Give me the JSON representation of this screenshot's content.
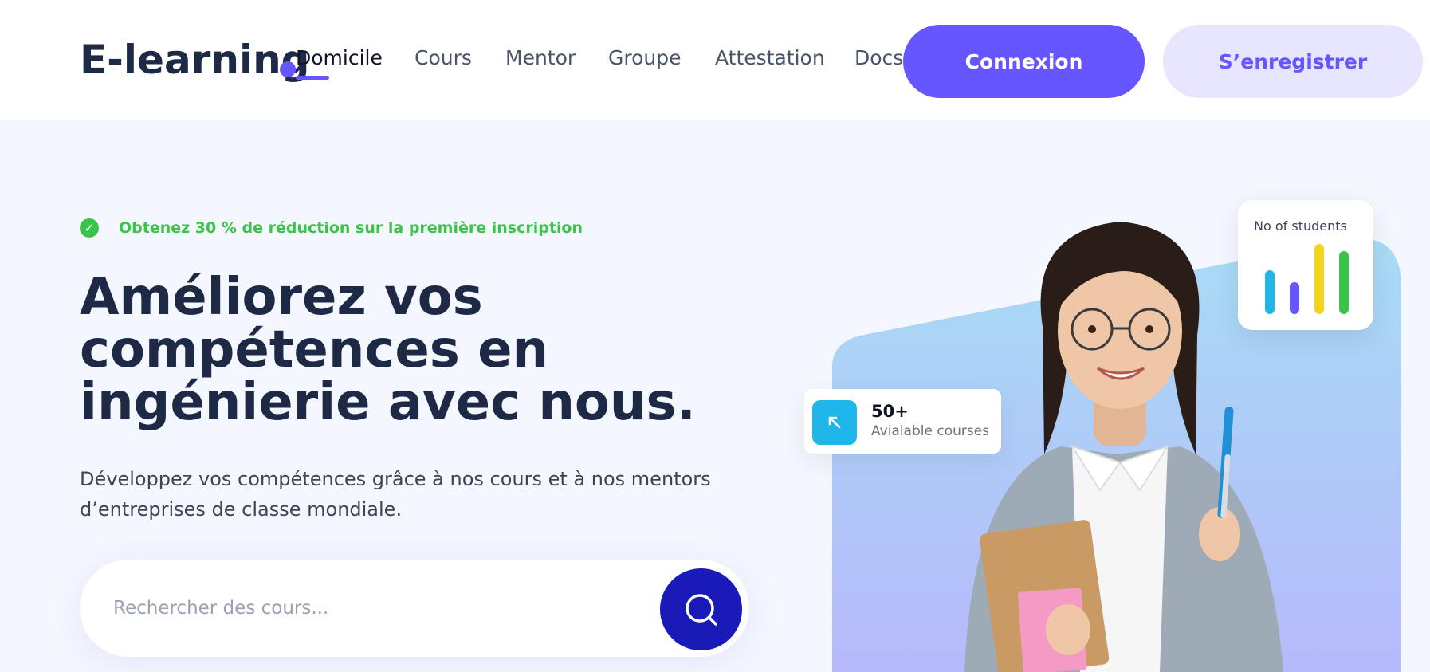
{
  "header": {
    "logo": "E-learning",
    "nav": [
      {
        "label": "Domicile",
        "active": true
      },
      {
        "label": "Cours",
        "active": false
      },
      {
        "label": "Mentor",
        "active": false
      },
      {
        "label": "Groupe",
        "active": false
      },
      {
        "label": "Attestation",
        "active": false
      },
      {
        "label": "Docs",
        "active": false
      }
    ],
    "login_label": "Connexion",
    "register_label": "S’enregistrer"
  },
  "hero": {
    "promo": "Obtenez 30 % de réduction sur la première inscription",
    "title_lines": [
      "Améliorez vos",
      "compétences en",
      "ingénierie avec nous."
    ],
    "description_lines": [
      "Développez vos compétences grâce à nos cours et à nos mentors",
      "d’entreprises de classe mondiale."
    ],
    "search": {
      "placeholder": "Rechercher des cours...",
      "value": ""
    }
  },
  "stats": {
    "students_title": "No of students",
    "students_bars": [
      {
        "level": 0.62,
        "color": "#1fb7ea"
      },
      {
        "level": 0.46,
        "color": "#6556ff"
      },
      {
        "level": 1.0,
        "color": "#f7d41c"
      },
      {
        "level": 0.9,
        "color": "#3cc44a"
      }
    ],
    "courses_count": "50+",
    "courses_label": "Avialable courses"
  },
  "icons": {
    "promo": "check-badge-icon",
    "search": "search-icon",
    "courses": "arrow-up-left-icon",
    "logo_dot": "dot-icon"
  },
  "colors": {
    "accent": "#6556ff",
    "accent_light": "#e7e5ff",
    "search_button": "#1a1ab8",
    "promo_green": "#3cc44a",
    "heading": "#1e2a45",
    "hero_gradient_top": "#a8dcf5",
    "hero_gradient_bottom": "#b7b8fb"
  }
}
